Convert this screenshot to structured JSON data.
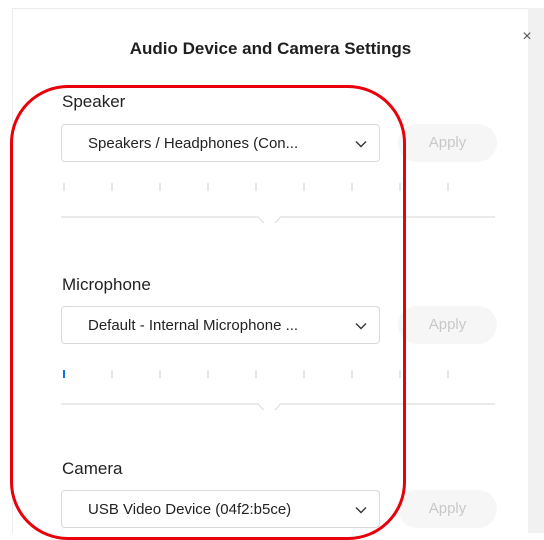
{
  "dialog": {
    "title": "Audio Device and Camera Settings",
    "close_icon": "close-icon",
    "close_glyph": "×"
  },
  "speaker": {
    "label": "Speaker",
    "selected": "Speakers / Headphones (Con...",
    "apply_label": "Apply",
    "apply_enabled": false,
    "active_ticks": 0,
    "volume_fraction": 0.48
  },
  "microphone": {
    "label": "Microphone",
    "selected": "Default - Internal Microphone ...",
    "apply_label": "Apply",
    "apply_enabled": false,
    "active_ticks": 1,
    "volume_fraction": 0.48
  },
  "camera": {
    "label": "Camera",
    "selected": "USB Video Device (04f2:b5ce)",
    "apply_label": "Apply",
    "apply_enabled": false
  },
  "colors": {
    "annotation": "#e8000b",
    "apply_text_disabled": "#c8c8c8",
    "tick_active": "#0e72ed",
    "tick_inactive": "#cfcfcf"
  }
}
